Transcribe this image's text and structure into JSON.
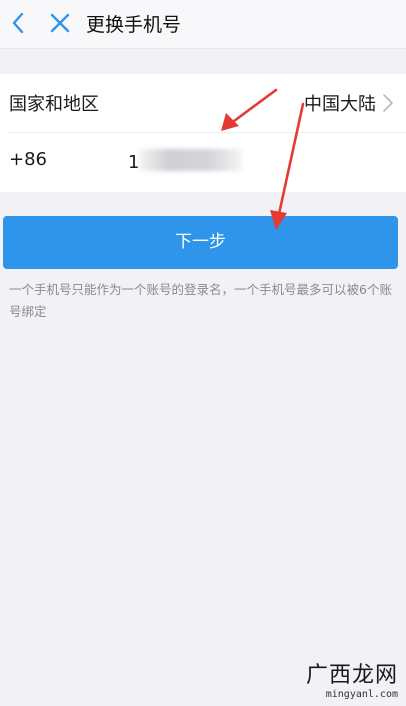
{
  "header": {
    "title": "更换手机号",
    "back_icon": "chevron-left-icon",
    "close_icon": "close-icon",
    "icon_color": "#2f95ea"
  },
  "form": {
    "region_label": "国家和地区",
    "region_value": "中国大陆",
    "country_code": "+86",
    "phone_value": "1"
  },
  "next_button": {
    "label": "下一步",
    "color": "#2f95ea"
  },
  "hint": "一个手机号只能作为一个账号的登录名，一个手机号最多可以被6个账号绑定",
  "annotation": {
    "arrow_color": "#e53935"
  },
  "watermark": {
    "text": "广西龙网",
    "domain": "mingyanl.com"
  }
}
